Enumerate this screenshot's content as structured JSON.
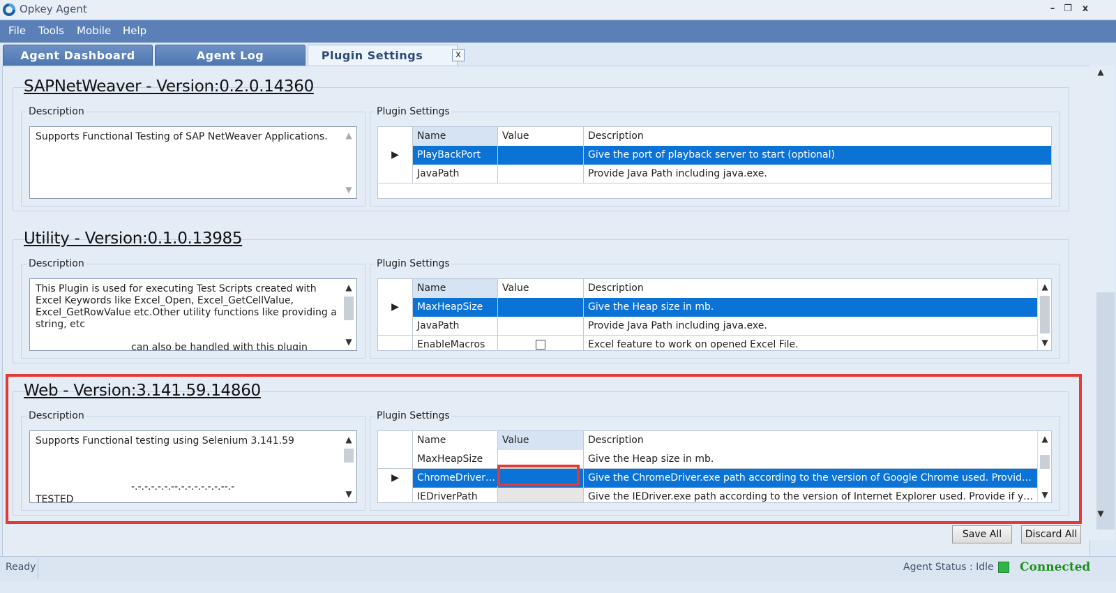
{
  "window": {
    "title": "Opkey Agent",
    "min": "–",
    "restore": "❐",
    "close": "x"
  },
  "menu": [
    "File",
    "Tools",
    "Mobile",
    "Help"
  ],
  "tabs": [
    "Agent Dashboard",
    "Agent Log",
    "Plugin Settings"
  ],
  "tab_close": "x",
  "labels": {
    "description": "Description",
    "plugin_settings": "Plugin Settings"
  },
  "columns": {
    "name": "Name",
    "value": "Value",
    "description": "Description"
  },
  "sections": [
    {
      "title": "SAPNetWeaver - Version:0.2.0.14360",
      "description": "Supports Functional Testing of SAP NetWeaver Applications.",
      "rows": [
        {
          "name": "PlayBackPort",
          "value": "",
          "description": "Give the port of playback server to start (optional)"
        },
        {
          "name": "JavaPath",
          "value": "",
          "description": "Provide Java Path including java.exe."
        }
      ]
    },
    {
      "title": "Utility - Version:0.1.0.13985",
      "description": "This Plugin is used for executing Test Scripts created with Excel Keywords like Excel_Open, Excel_GetCellValue, Excel_GetRowValue etc.Other utility functions like providing a string, etc",
      "description_extra": "can also be handled with this plugin",
      "rows": [
        {
          "name": "MaxHeapSize",
          "value": "",
          "description": "Give the Heap size in mb."
        },
        {
          "name": "JavaPath",
          "value": "",
          "description": "Provide Java Path including java.exe."
        },
        {
          "name": "EnableMacros",
          "value": "",
          "description": "Excel feature to work on opened Excel File."
        }
      ]
    },
    {
      "title": "Web - Version:3.141.59.14860",
      "description": "Supports Functional testing using Selenium 3.141.59",
      "description_dashes": "-.-.-.-.-.-.--.-.-.-.-.-.-.--.-",
      "description_extra": "TESTED",
      "rows": [
        {
          "name": "MaxHeapSize",
          "value": "",
          "description": "Give the Heap size in mb."
        },
        {
          "name": "ChromeDriverP...",
          "value": "",
          "description": "Give the ChromeDriver.exe path according to the version of Google Chrome used. Provide if ..."
        },
        {
          "name": "IEDriverPath",
          "value": "",
          "description": "Give the IEDriver.exe path according to the version of Internet Explorer used. Provide if you..."
        }
      ]
    }
  ],
  "buttons": {
    "save_all": "Save All",
    "discard_all": "Discard All"
  },
  "status": {
    "ready": "Ready",
    "agent_status": "Agent Status : Idle",
    "connection": "Connected"
  },
  "colors": {
    "selection": "#0b72d6",
    "highlight": "#e53935",
    "connected": "#1e8f1e"
  }
}
